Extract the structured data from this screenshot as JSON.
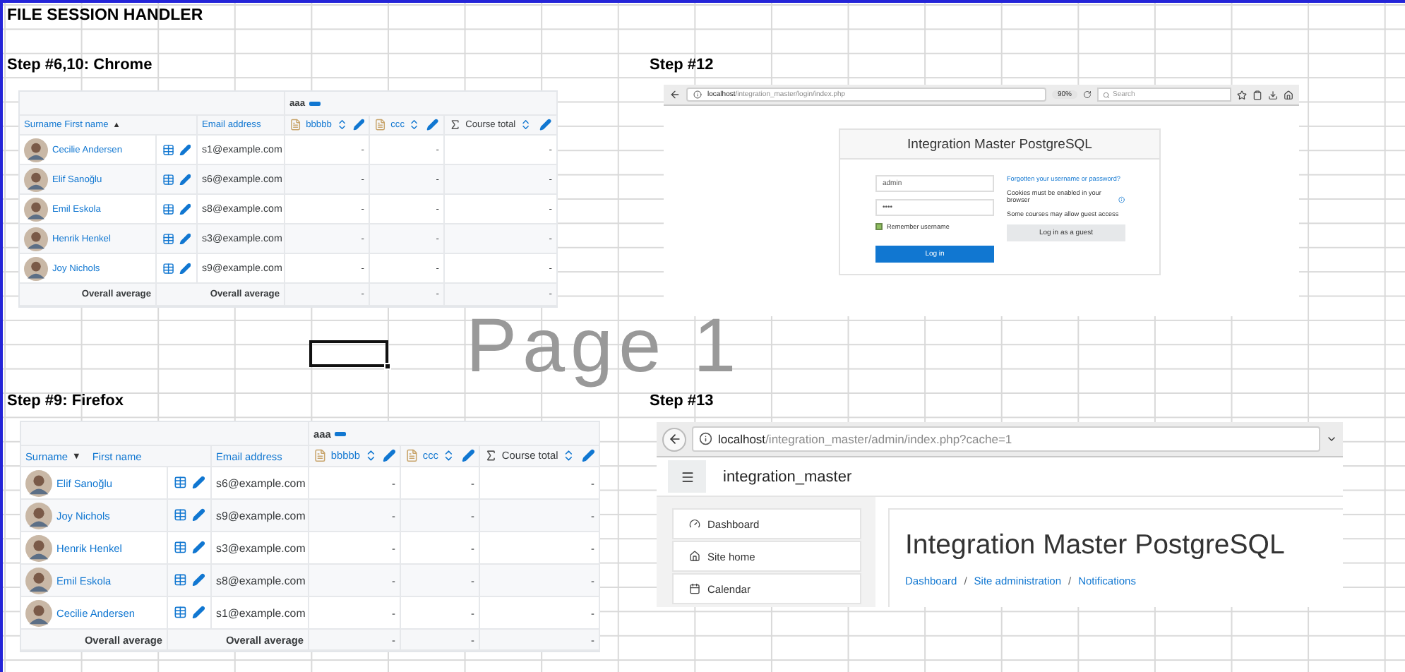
{
  "sheet": {
    "title": "FILE SESSION HANDLER",
    "watermark": "Page 1"
  },
  "snapshots": [
    {
      "kind": "grader",
      "caption": "Step #6,10: Chrome",
      "group": "aaa",
      "name_headers": [
        {
          "label": "Surname First name",
          "sort_marker": "▲"
        }
      ],
      "email_header": "Email address",
      "grade_columns": [
        {
          "label": "bbbbb",
          "kind": "item"
        },
        {
          "label": "ccc",
          "kind": "item"
        },
        {
          "label": "Course total",
          "kind": "total"
        }
      ],
      "rows": [
        {
          "name": "Cecilie Andersen",
          "email": "s1@example.com",
          "grades": [
            "-",
            "-",
            "-"
          ]
        },
        {
          "name": "Elif Sanoğlu",
          "email": "s6@example.com",
          "grades": [
            "-",
            "-",
            "-"
          ]
        },
        {
          "name": "Emil Eskola",
          "email": "s8@example.com",
          "grades": [
            "-",
            "-",
            "-"
          ]
        },
        {
          "name": "Henrik Henkel",
          "email": "s3@example.com",
          "grades": [
            "-",
            "-",
            "-"
          ]
        },
        {
          "name": "Joy Nichols",
          "email": "s9@example.com",
          "grades": [
            "-",
            "-",
            "-"
          ]
        }
      ],
      "footer": {
        "labels": [
          "Overall average",
          "Overall average"
        ],
        "grades": [
          "-",
          "-",
          "-"
        ]
      }
    },
    {
      "kind": "login",
      "caption": "Step #12",
      "url_host": "localhost",
      "url_path": "/integration_master/login/index.php",
      "zoom": "90%",
      "search_placeholder": "Search",
      "site_title": "Integration Master PostgreSQL",
      "username": "admin",
      "password": "••••",
      "remember": {
        "label": "Remember username",
        "checked": true
      },
      "login_button": "Log in",
      "forgot_link": "Forgotten your username or password?",
      "cookies_note": "Cookies must be enabled in your browser",
      "guest_note": "Some courses may allow guest access",
      "guest_button": "Log in as a guest"
    },
    {
      "kind": "grader",
      "caption": "Step #9: Firefox",
      "group": "aaa",
      "name_headers": [
        {
          "label": "Surname",
          "sort_marker": "▼"
        },
        {
          "label": "First name"
        }
      ],
      "email_header": "Email address",
      "grade_columns": [
        {
          "label": "bbbbb",
          "kind": "item"
        },
        {
          "label": "ccc",
          "kind": "item"
        },
        {
          "label": "Course total",
          "kind": "total"
        }
      ],
      "rows": [
        {
          "name": "Elif Sanoğlu",
          "email": "s6@example.com",
          "grades": [
            "-",
            "-",
            "-"
          ]
        },
        {
          "name": "Joy Nichols",
          "email": "s9@example.com",
          "grades": [
            "-",
            "-",
            "-"
          ]
        },
        {
          "name": "Henrik Henkel",
          "email": "s3@example.com",
          "grades": [
            "-",
            "-",
            "-"
          ]
        },
        {
          "name": "Emil Eskola",
          "email": "s8@example.com",
          "grades": [
            "-",
            "-",
            "-"
          ]
        },
        {
          "name": "Cecilie Andersen",
          "email": "s1@example.com",
          "grades": [
            "-",
            "-",
            "-"
          ]
        }
      ],
      "footer": {
        "labels": [
          "Overall average",
          "Overall average"
        ],
        "grades": [
          "-",
          "-",
          "-"
        ]
      }
    },
    {
      "kind": "admin",
      "caption": "Step #13",
      "url_host": "localhost",
      "url_path": "/integration_master/admin/index.php?cache=1",
      "site_name": "integration_master",
      "nav": [
        {
          "label": "Dashboard"
        },
        {
          "label": "Site home"
        },
        {
          "label": "Calendar"
        }
      ],
      "heading": "Integration Master PostgreSQL",
      "breadcrumbs": [
        "Dashboard",
        "/",
        "Site administration",
        "/",
        "Notifications"
      ]
    }
  ]
}
